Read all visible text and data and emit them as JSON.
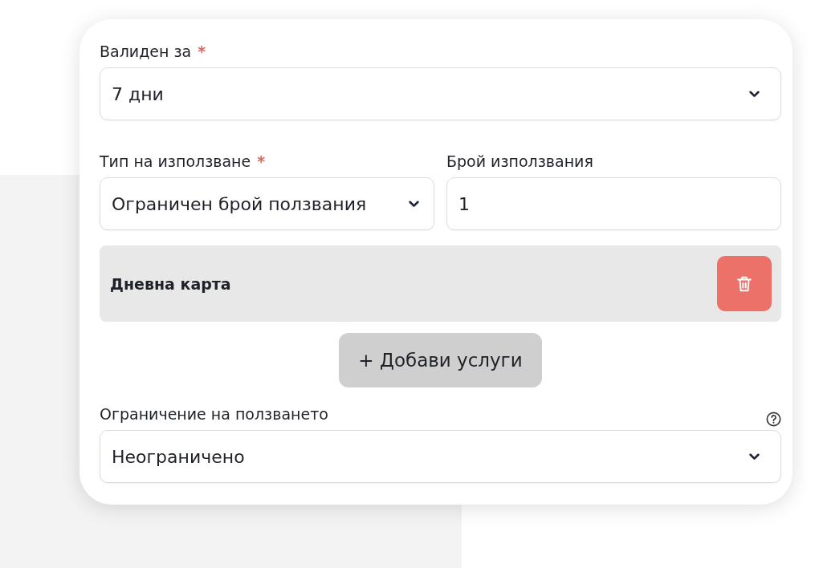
{
  "validity": {
    "label": "Валиден за",
    "required_mark": "*",
    "value": "7 дни"
  },
  "usage_type": {
    "label": "Тип на използване",
    "required_mark": "*",
    "value": "Ограничен брой ползвания"
  },
  "usage_count": {
    "label": "Брой използвания",
    "value": "1"
  },
  "services": [
    {
      "name": "Дневна карта"
    }
  ],
  "add_service_button": "+ Добави услуги",
  "usage_restriction": {
    "label": "Ограничение на ползването",
    "value": "Неограничено"
  }
}
